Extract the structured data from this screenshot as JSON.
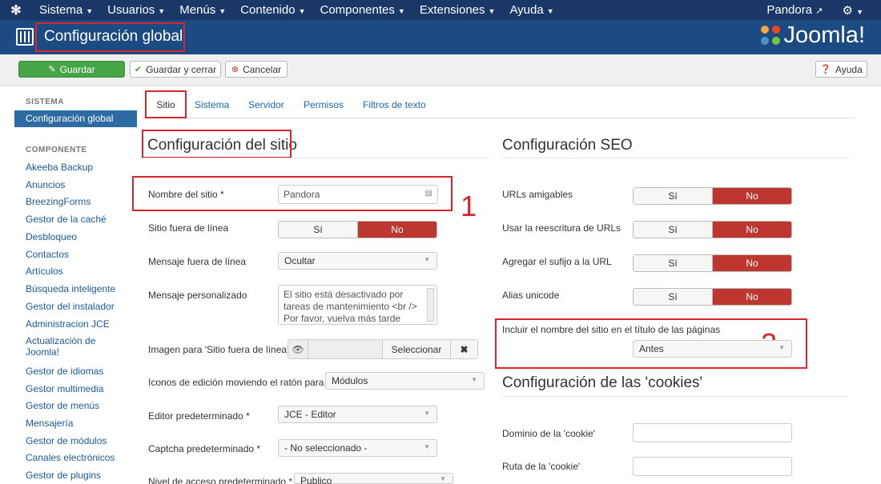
{
  "topnav": {
    "menu": [
      "Sistema",
      "Usuarios",
      "Menús",
      "Contenido",
      "Componentes",
      "Extensiones",
      "Ayuda"
    ],
    "user": "Pandora"
  },
  "header": {
    "title": "Configuración global",
    "brand": "Joomla!"
  },
  "toolbar": {
    "save": "Guardar",
    "save_close": "Guardar y cerrar",
    "cancel": "Cancelar",
    "help": "Ayuda"
  },
  "sidebar": {
    "system_heading": "SISTEMA",
    "system_items": [
      "Configuración global"
    ],
    "component_heading": "COMPONENTE",
    "component_items": [
      "Akeeba Backup",
      "Anuncios",
      "BreezingForms",
      "Gestor de la caché",
      "Desbloqueo",
      "Contactos",
      "Artículos",
      "Búsqueda inteligente",
      "Gestor del instalador",
      "Administracion JCE",
      "Actualización de Joomla!",
      "Gestor de idiomas",
      "Gestor multimedia",
      "Gestor de menús",
      "Mensajería",
      "Gestor de módulos",
      "Canales electrónicos",
      "Gestor de plugins"
    ]
  },
  "tabs": [
    "Sitio",
    "Sistema",
    "Servidor",
    "Permisos",
    "Filtros de texto"
  ],
  "site": {
    "title": "Configuración del sitio",
    "site_name_label": "Nombre del sitio *",
    "site_name_value": "Pandora",
    "offline_label": "Sitio fuera de línea",
    "offline_message_label": "Mensaje fuera de línea",
    "offline_message_value": "Ocultar",
    "custom_message_label": "Mensaje personalizado",
    "custom_message_value": "El sitio está desactivado por tareas de mantenimiento <br /> Por favor, vuelva más tarde",
    "offline_image_label": "Imagen para 'Sitio fuera de línea'",
    "select_label": "Seleccionar",
    "edit_icons_label": "Iconos de edición moviendo el ratón para",
    "edit_icons_value": "Módulos",
    "editor_label": "Editor predeterminado *",
    "editor_value": "JCE - Editor",
    "captcha_label": "Captcha predeterminado *",
    "captcha_value": "- No seleccionado -",
    "access_label": "Nivel de acceso predeterminado *",
    "access_value": "Publico"
  },
  "seo": {
    "title": "Configuración SEO",
    "sef_label": "URLs amigables",
    "rewrite_label": "Usar la reescritura de URLs",
    "suffix_label": "Agregar el sufijo a la URL",
    "unicode_label": "Alias unicode",
    "sitename_pages_label": "Incluir el nombre del sitio en el título de las páginas",
    "sitename_pages_value": "Antes"
  },
  "cookies": {
    "title": "Configuración de las 'cookies'",
    "domain_label": "Dominio de la 'cookie'",
    "path_label": "Ruta de la 'cookie'"
  },
  "toggle": {
    "yes": "Sí",
    "no": "No"
  },
  "annotations": {
    "n1": "1",
    "n2": "2"
  },
  "colors": {
    "nav": "#1a3867",
    "header": "#1b4b82",
    "green": "#46a546",
    "no_red": "#bd362f",
    "annotation_red": "#d7262d",
    "link": "#1a6ab1"
  }
}
